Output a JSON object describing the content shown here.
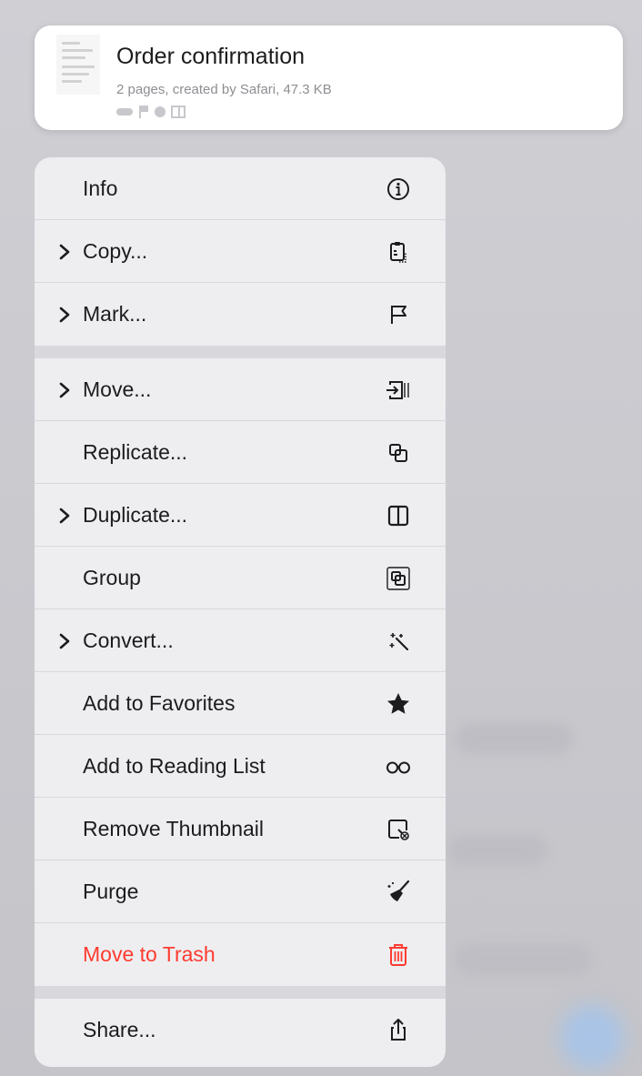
{
  "preview": {
    "title": "Order confirmation",
    "subtitle": "2 pages, created by Safari, 47.3 KB",
    "tags": [
      "tag-pill",
      "flag-icon",
      "dot-icon",
      "columns-icon"
    ]
  },
  "menu": {
    "items": [
      {
        "label": "Info",
        "icon": "info-circle-icon",
        "has_chevron": false
      },
      {
        "label": "Copy...",
        "icon": "clipboard-icon",
        "has_chevron": true
      },
      {
        "label": "Mark...",
        "icon": "flag-icon",
        "has_chevron": true
      },
      {
        "label": "Move...",
        "icon": "move-into-icon",
        "has_chevron": true
      },
      {
        "label": "Replicate...",
        "icon": "replicate-icon",
        "has_chevron": false
      },
      {
        "label": "Duplicate...",
        "icon": "split-square-icon",
        "has_chevron": true
      },
      {
        "label": "Group",
        "icon": "group-icon",
        "has_chevron": false
      },
      {
        "label": "Convert...",
        "icon": "magic-wand-icon",
        "has_chevron": true
      },
      {
        "label": "Add to Favorites",
        "icon": "star-icon",
        "has_chevron": false
      },
      {
        "label": "Add to Reading List",
        "icon": "glasses-icon",
        "has_chevron": false
      },
      {
        "label": "Remove Thumbnail",
        "icon": "remove-thumbnail-icon",
        "has_chevron": false
      },
      {
        "label": "Purge",
        "icon": "broom-icon",
        "has_chevron": false
      },
      {
        "label": "Move to Trash",
        "icon": "trash-icon",
        "has_chevron": false,
        "destructive": true
      },
      {
        "label": "Share...",
        "icon": "share-icon",
        "has_chevron": false
      }
    ]
  },
  "colors": {
    "destructive": "#ff3b30",
    "text": "#1c1c1e",
    "secondary_text": "#8e8e93",
    "menu_background": "#eeeef0"
  }
}
